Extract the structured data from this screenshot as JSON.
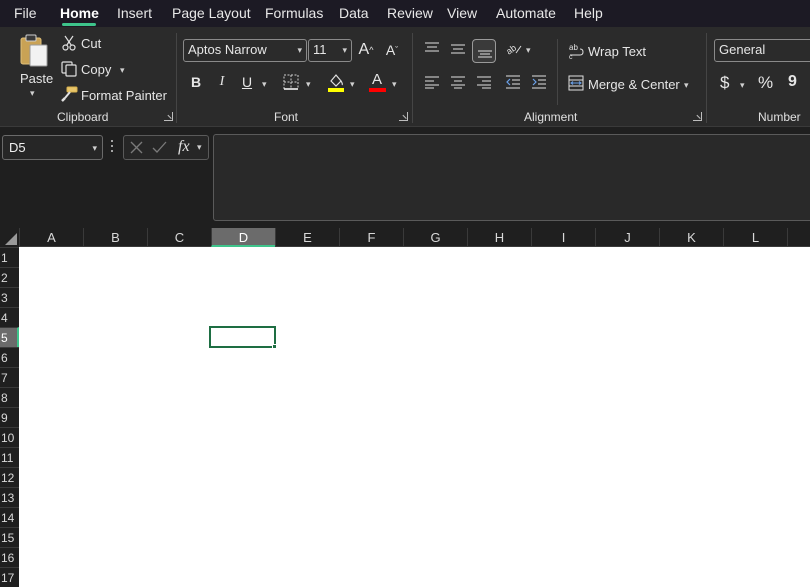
{
  "menu": {
    "items": [
      "File",
      "Home",
      "Insert",
      "Page Layout",
      "Formulas",
      "Data",
      "Review",
      "View",
      "Automate",
      "Help"
    ],
    "active": "Home"
  },
  "ribbon": {
    "clipboard": {
      "label": "Clipboard",
      "paste": "Paste",
      "cut": "Cut",
      "copy": "Copy",
      "format_painter": "Format Painter"
    },
    "font": {
      "label": "Font",
      "font_name": "Aptos Narrow",
      "font_size": "11",
      "grow": "A",
      "shrink": "A",
      "bold": "B",
      "italic": "I",
      "underline": "U",
      "font_color_letter": "A"
    },
    "alignment": {
      "label": "Alignment",
      "wrap_text": "Wrap Text",
      "merge_center": "Merge & Center"
    },
    "number": {
      "label": "Number",
      "format": "General",
      "currency": "$",
      "percent": "%",
      "comma": "9"
    },
    "colors": {
      "highlight": "#ffff00",
      "font_color": "#ff0000",
      "accent": "#3ec48b"
    }
  },
  "formula_bar": {
    "name_box": "D5",
    "fx": "fx",
    "value": ""
  },
  "grid": {
    "columns": [
      "A",
      "B",
      "C",
      "D",
      "E",
      "F",
      "G",
      "H",
      "I",
      "J",
      "K",
      "L"
    ],
    "rows": [
      "1",
      "2",
      "3",
      "4",
      "5",
      "6",
      "7",
      "8",
      "9",
      "10",
      "11",
      "12",
      "13",
      "14",
      "15",
      "16",
      "17"
    ],
    "selected_column": "D",
    "selected_row": "5"
  }
}
